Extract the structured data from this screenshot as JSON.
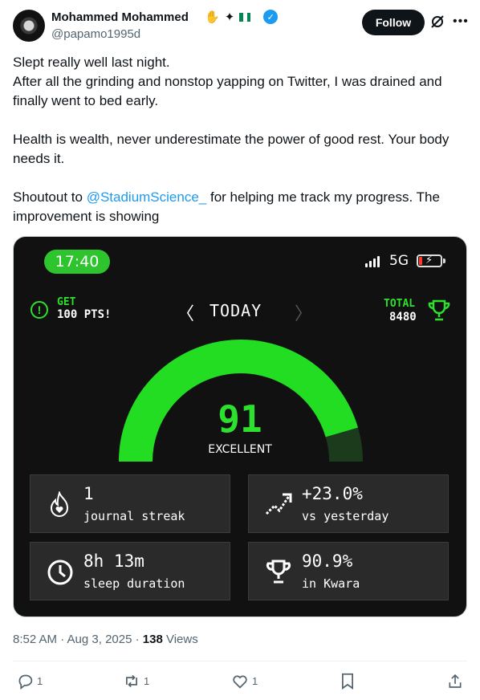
{
  "author": {
    "name": "Mohammed Mohammed",
    "handle": "@papamo1995d",
    "badges": [
      "✋",
      "✦"
    ],
    "flag_colors": [
      "#008751",
      "#ffffff",
      "#008751"
    ],
    "verified_icon": "verified-badge-icon"
  },
  "follow_label": "Follow",
  "tweet": {
    "line1": "Slept really well last night.",
    "line2": "After all the grinding and nonstop yapping on Twitter, I was drained and finally went to bed early.",
    "line3": "Health is wealth, never underestimate the power of good rest. Your body needs it.",
    "line4_pre": "Shoutout to ",
    "mention": "@StadiumScience_",
    "line4_post": " for helping me track my progress. The improvement is showing"
  },
  "app": {
    "time": "17:40",
    "network": "5G",
    "get_label": "GET",
    "get_points": "100 PTS!",
    "day_label": "TODAY",
    "total_label": "TOTAL",
    "total_value": "8480",
    "score": "91",
    "score_label": "EXCELLENT",
    "score_max": 100,
    "cards": [
      {
        "value": "1",
        "label": "journal streak",
        "icon": "flame-heart-icon"
      },
      {
        "value": "+23.0%",
        "label": "vs yesterday",
        "icon": "trend-up-icon"
      },
      {
        "value": "8h 13m",
        "label": "sleep duration",
        "icon": "clock-icon"
      },
      {
        "value": "90.9%",
        "label": "in Kwara",
        "icon": "trophy-icon"
      }
    ],
    "accent_color": "#2ee02e"
  },
  "meta": {
    "time_date": "8:52 AM · Aug 3, 2025 · ",
    "views_count": "138",
    "views_label": " Views"
  },
  "actions": {
    "replies": "1",
    "reposts": "1",
    "likes": "1"
  }
}
